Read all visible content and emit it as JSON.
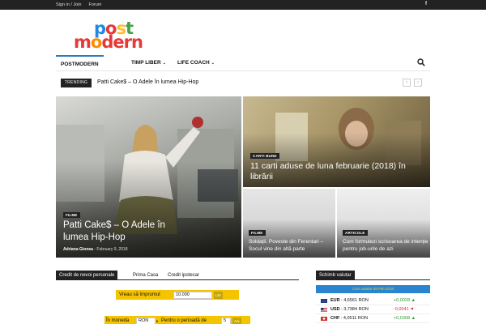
{
  "topbar": {
    "signin": "Sign in / Join",
    "forum": "Forum",
    "facebook_icon": "facebook-icon"
  },
  "logo": {
    "line1": [
      "p",
      "o",
      "s",
      "t"
    ],
    "line2": [
      "m",
      "o",
      "d",
      "e",
      "r",
      "n"
    ]
  },
  "nav": {
    "items": [
      {
        "label": "POSTMODERN",
        "active": true
      },
      {
        "label": "TIMP LIBER",
        "caret": "⌄"
      },
      {
        "label": "LIFE COACH",
        "caret": "⌄"
      }
    ],
    "search_icon": "search-icon"
  },
  "trending": {
    "badge": "TRENDING",
    "text": "Patti Cake$ – O Adele în lumea Hip-Hop",
    "prev": "‹",
    "next": "›"
  },
  "featured": [
    {
      "category": "FILME",
      "title": "Patti Cake$ – O Adele în lumea Hip-Hop",
      "author": "Adriana Gionea",
      "sep": " - ",
      "date": "February 9, 2018"
    },
    {
      "category": "CARTI BUNE",
      "title": "11 carti aduse de luna februarie (2018) în librării"
    },
    {
      "category": "FILME",
      "title": "Soldații. Poveste din Ferentari – Socul vine din altă parte"
    },
    {
      "category": "ARTICOLE",
      "title": "Cum formulezi scrisoarea de intenție pentru job-urile de azi"
    }
  ],
  "credit": {
    "tabs": [
      "Credit de nevoi personale",
      "Prima Casa",
      "Credit ipotecar"
    ],
    "want_label": "Vreau să împrumut",
    "amount": "10.000",
    "amount_unit": "LEI",
    "currency_label": "În moneda",
    "currency": "RON",
    "period_label": "Pentru o perioadă de",
    "period": "5",
    "period_unit": "Ani"
  },
  "fx": {
    "title": "Schimb valutar",
    "date": "Curs valutar 09 Feb 2018",
    "rows": [
      {
        "code": "EUR",
        "rate": "4,6561 RON",
        "change": "+0,0028",
        "dir": "▲",
        "color": "#2e9a2e"
      },
      {
        "code": "USD",
        "rate": "3,7984 RON",
        "change": "-0,0041",
        "dir": "▼",
        "color": "#d32f2f"
      },
      {
        "code": "CHF",
        "rate": "4,0511 RON",
        "change": "+0,0308",
        "dir": "▲",
        "color": "#2e9a2e"
      }
    ]
  }
}
